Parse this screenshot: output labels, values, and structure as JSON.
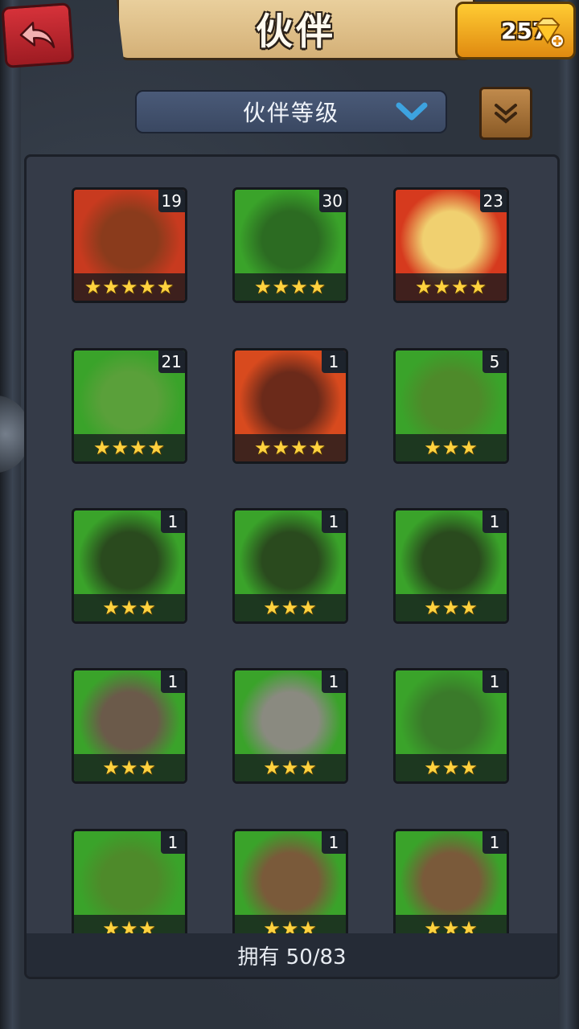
{
  "header": {
    "title": "伙伴",
    "back_icon": "back-arrow-icon"
  },
  "currency": {
    "gems": "257",
    "icon": "gem-icon"
  },
  "sort": {
    "label": "伙伴等级"
  },
  "companions": [
    {
      "level": "19",
      "stars": "★★★★★",
      "bg": "#c83a1f",
      "tint": "#8a3b1c"
    },
    {
      "level": "30",
      "stars": "★★★★",
      "bg": "#3aa32a",
      "tint": "#2c6b22"
    },
    {
      "level": "23",
      "stars": "★★★★",
      "bg": "#d63a1e",
      "tint": "#f0d070"
    },
    {
      "level": "21",
      "stars": "★★★★",
      "bg": "#3aa32a",
      "tint": "#5aa03a"
    },
    {
      "level": "1",
      "stars": "★★★★",
      "bg": "#d84a1e",
      "tint": "#6b2a1a"
    },
    {
      "level": "5",
      "stars": "★★★",
      "bg": "#3aa32a",
      "tint": "#4e8a2a"
    },
    {
      "level": "1",
      "stars": "★★★",
      "bg": "#3aa32a",
      "tint": "#2a4a1e"
    },
    {
      "level": "1",
      "stars": "★★★",
      "bg": "#3aa32a",
      "tint": "#2a4a1e"
    },
    {
      "level": "1",
      "stars": "★★★",
      "bg": "#3aa32a",
      "tint": "#2a4a1e"
    },
    {
      "level": "1",
      "stars": "★★★",
      "bg": "#3aa32a",
      "tint": "#6b5a4a"
    },
    {
      "level": "1",
      "stars": "★★★",
      "bg": "#3aa32a",
      "tint": "#8a8a80"
    },
    {
      "level": "1",
      "stars": "★★★",
      "bg": "#3aa32a",
      "tint": "#3a7a2a"
    },
    {
      "level": "1",
      "stars": "★★★",
      "bg": "#3aa32a",
      "tint": "#4e8a2a"
    },
    {
      "level": "1",
      "stars": "★★★",
      "bg": "#3aa32a",
      "tint": "#7a5a3a"
    },
    {
      "level": "1",
      "stars": "★★★",
      "bg": "#3aa32a",
      "tint": "#7a5a3a"
    }
  ],
  "footer": {
    "owned": "拥有 50/83"
  }
}
